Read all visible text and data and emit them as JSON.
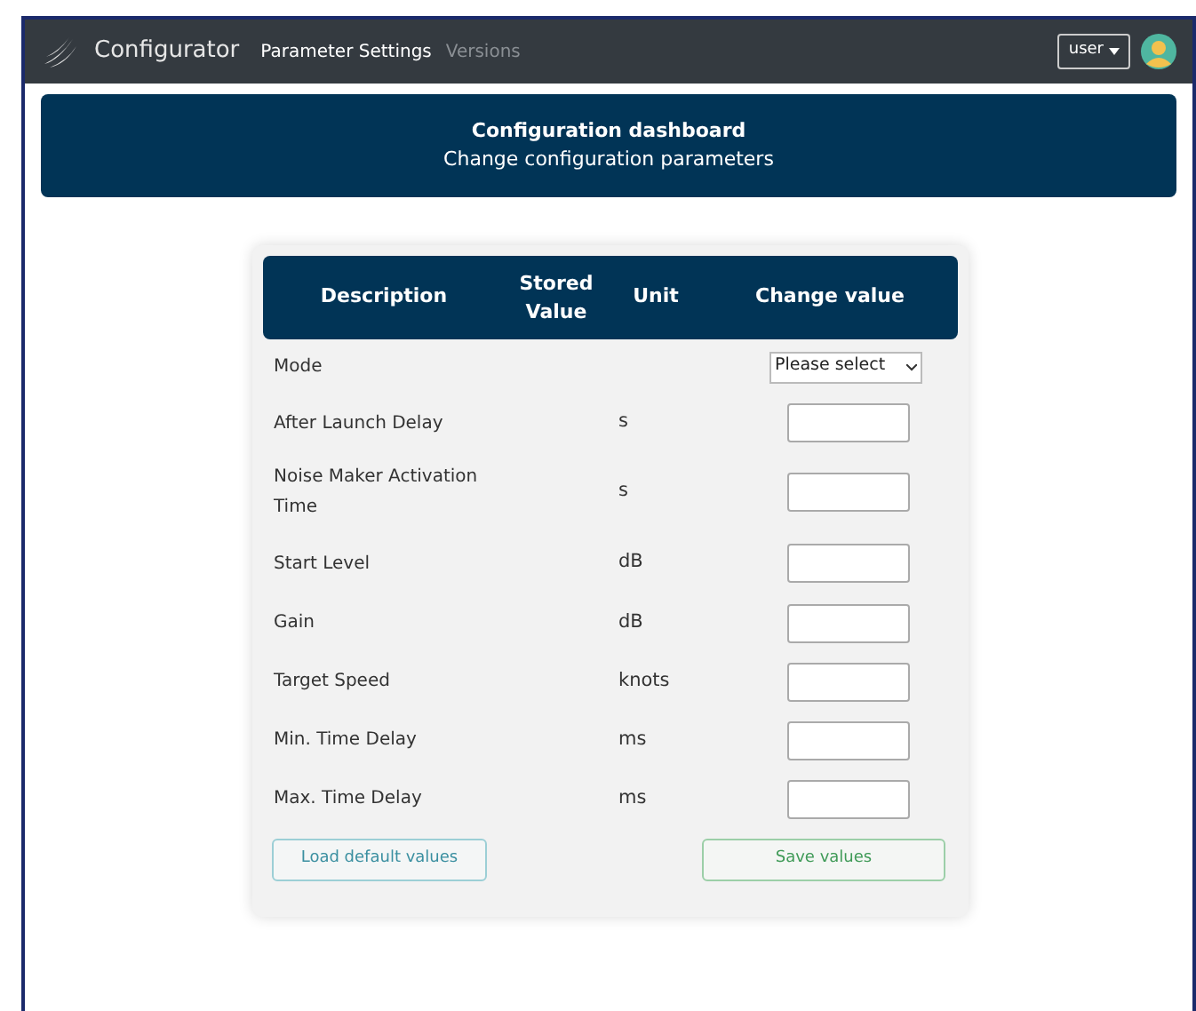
{
  "navbar": {
    "brand": "Configurator",
    "links": [
      {
        "label": "Parameter Settings",
        "selected": true
      },
      {
        "label": "Versions",
        "selected": false
      }
    ],
    "user_menu": "user"
  },
  "banner": {
    "title": "Configuration dashboard",
    "subtitle": "Change configuration parameters"
  },
  "table": {
    "columns": [
      "Description",
      "Stored Value",
      "Unit",
      "Change value"
    ],
    "rows": [
      {
        "kind": "select",
        "description": "Mode",
        "unit": "",
        "placeholder": "Please select"
      },
      {
        "kind": "input",
        "description": "After Launch Delay",
        "unit": "s"
      },
      {
        "kind": "input",
        "description": "Noise Maker Activation Time",
        "unit": "s"
      },
      {
        "kind": "input",
        "description": "Start Level",
        "unit": "dB"
      },
      {
        "kind": "input",
        "description": "Gain",
        "unit": "dB"
      },
      {
        "kind": "input",
        "description": "Target Speed",
        "unit": "knots"
      },
      {
        "kind": "input",
        "description": "Min. Time Delay",
        "unit": "ms"
      },
      {
        "kind": "input",
        "description": "Max. Time Delay",
        "unit": "ms"
      }
    ]
  },
  "buttons": [
    "Load default values",
    "Save values"
  ]
}
